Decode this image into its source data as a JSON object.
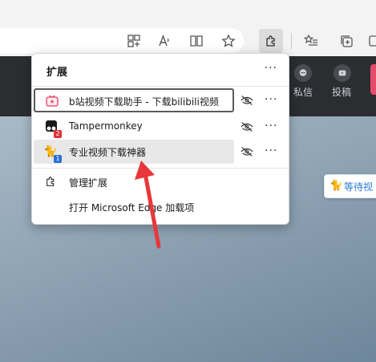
{
  "toolbar": {
    "icons": [
      "split-screen-icon",
      "read-aloud-icon",
      "reading-view-icon",
      "favorite-star-icon",
      "extensions-puzzle-icon",
      "favorites-list-icon",
      "collections-icon",
      "more-icon"
    ]
  },
  "site": {
    "items": [
      {
        "label": "私信"
      },
      {
        "label": "投稿"
      }
    ]
  },
  "floating_chip": {
    "label": "等待视"
  },
  "popup": {
    "title": "扩展",
    "more": "···",
    "extensions": [
      {
        "name": "b站视频下载助手 - 下载bilibili视频",
        "badge": ""
      },
      {
        "name": "Tampermonkey",
        "badge": "2"
      },
      {
        "name": "专业视频下载神器",
        "badge": "1"
      }
    ],
    "row_more": "···",
    "menu": {
      "manage": "管理扩展",
      "open_addons": "打开 Microsoft Edge 加载项"
    }
  },
  "colors": {
    "site_header": "#2b2d31",
    "badge_red": "#e0303a",
    "badge_blue": "#2b6fd6",
    "arrow_red": "#e8373a"
  }
}
